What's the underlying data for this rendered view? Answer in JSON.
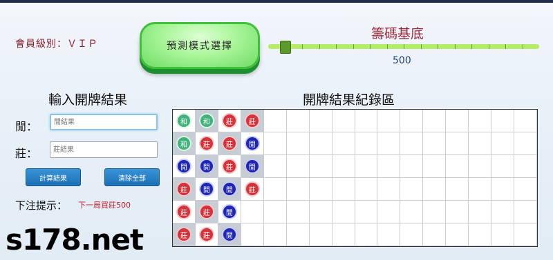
{
  "member": {
    "label": "會員級別：ＶＩＰ"
  },
  "mode_button": {
    "label": "預測模式選擇"
  },
  "chip_base": {
    "title": "籌碼基底",
    "value": "500",
    "slider_fraction": 0.06
  },
  "input": {
    "title": "輸入開牌結果",
    "xian_label": "閒：",
    "xian_placeholder": "閒結果",
    "zhuang_label": "莊：",
    "zhuang_placeholder": "莊結果",
    "calc_button": "計算結果",
    "clear_button": "清除全部"
  },
  "hint": {
    "label": "下注提示：",
    "text": "下一局買莊500"
  },
  "record": {
    "title": "開牌結果紀錄區",
    "columns": [
      [
        "和",
        "和",
        "閒",
        "莊",
        "莊",
        "莊"
      ],
      [
        "和",
        "莊",
        "閒",
        "閒",
        "莊",
        "莊"
      ],
      [
        "莊",
        "莊",
        "莊",
        "閒",
        "閒",
        "閒"
      ],
      [
        "莊",
        "閒",
        "閒",
        "莊"
      ]
    ]
  },
  "colors": {
    "he": "#3fb37b",
    "zhuang": "#d6323a",
    "xian": "#1e26b8"
  },
  "watermark": "s178.net"
}
